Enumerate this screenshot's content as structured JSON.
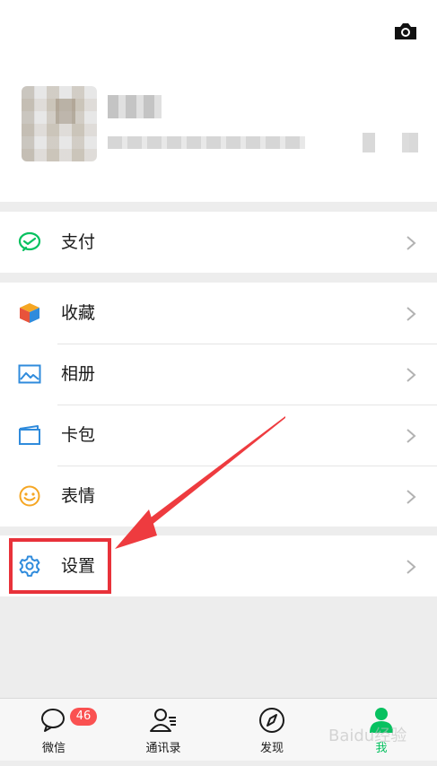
{
  "menu": {
    "group1": [
      {
        "id": "pay",
        "label": "支付",
        "icon": "wechat-pay-icon",
        "color": "#07c160"
      }
    ],
    "group2": [
      {
        "id": "favorites",
        "label": "收藏",
        "icon": "cube-icon",
        "color": "#f5a623"
      },
      {
        "id": "album",
        "label": "相册",
        "icon": "picture-icon",
        "color": "#2f8bdc"
      },
      {
        "id": "cards",
        "label": "卡包",
        "icon": "card-icon",
        "color": "#2f8bdc"
      },
      {
        "id": "stickers",
        "label": "表情",
        "icon": "smiley-icon",
        "color": "#f5a623"
      }
    ],
    "group3": [
      {
        "id": "settings",
        "label": "设置",
        "icon": "gear-icon",
        "color": "#2f8bdc"
      }
    ]
  },
  "tabbar": {
    "tabs": [
      {
        "id": "chats",
        "label": "微信",
        "icon": "chat-bubble-icon",
        "badge": "46",
        "active": false
      },
      {
        "id": "contacts",
        "label": "通讯录",
        "icon": "contacts-icon",
        "active": false
      },
      {
        "id": "discover",
        "label": "发现",
        "icon": "compass-icon",
        "active": false
      },
      {
        "id": "me",
        "label": "我",
        "icon": "person-icon",
        "active": true
      }
    ]
  },
  "watermark": "Baidu经验",
  "colors": {
    "accent": "#07c160",
    "highlight": "#e8323a",
    "badge": "#fa5151"
  }
}
